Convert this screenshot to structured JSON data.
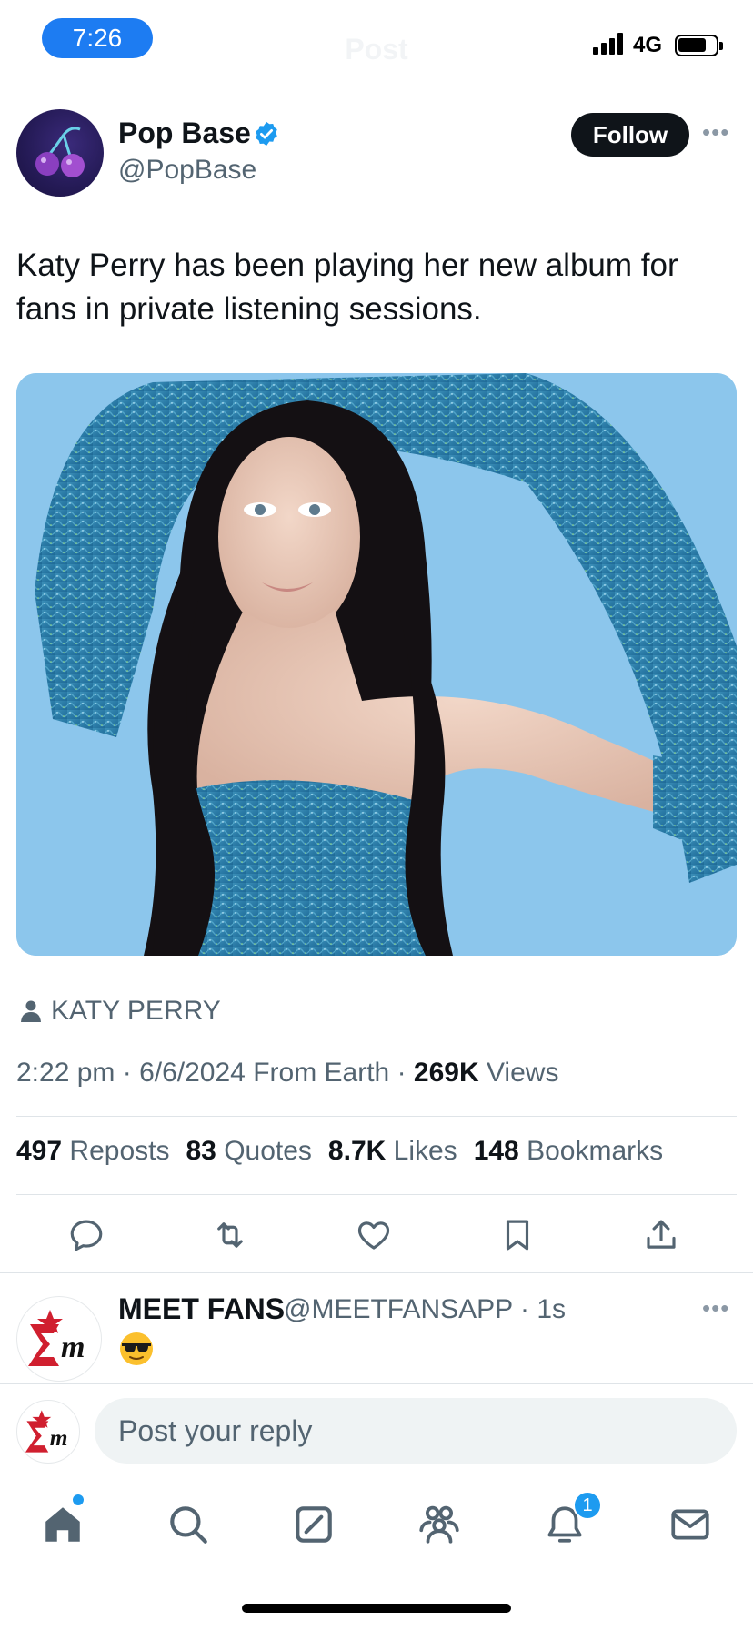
{
  "status_bar": {
    "time": "7:26",
    "network": "4G"
  },
  "header": {
    "title": "Post"
  },
  "author": {
    "name": "Pop Base",
    "handle": "@PopBase",
    "follow_label": "Follow"
  },
  "tweet": {
    "text": "Katy Perry has been playing her new album for fans in private listening sessions.",
    "tagged_user": "KATY PERRY",
    "time": "2:22 pm",
    "date": "6/6/2024",
    "source": "From Earth",
    "views_count": "269K",
    "views_label": "Views"
  },
  "stats": {
    "reposts": {
      "count": "497",
      "label": "Reposts"
    },
    "quotes": {
      "count": "83",
      "label": "Quotes"
    },
    "likes": {
      "count": "8.7K",
      "label": "Likes"
    },
    "bookmarks": {
      "count": "148",
      "label": "Bookmarks"
    }
  },
  "actions": [
    "reply-icon",
    "repost-icon",
    "like-icon",
    "bookmark-icon",
    "share-icon"
  ],
  "reply": {
    "name": "MEET FANS",
    "handle": "@MEETFANSAPP",
    "age": "1s",
    "emoji": "sunglasses"
  },
  "compose": {
    "placeholder": "Post your reply"
  },
  "tab_bar": {
    "items": [
      "home-icon",
      "search-icon",
      "grok-icon",
      "communities-icon",
      "notifications-icon",
      "messages-icon"
    ],
    "notification_count": "1"
  },
  "colors": {
    "accent": "#1d9bf0",
    "time_pill": "#1d7cf2",
    "text": "#0f1419",
    "muted": "#536471"
  }
}
